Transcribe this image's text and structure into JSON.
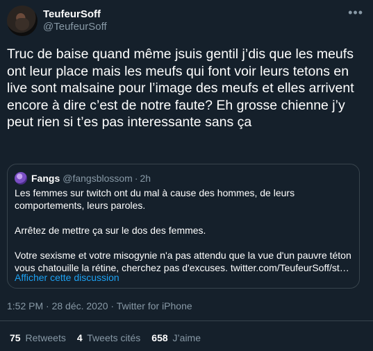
{
  "author": {
    "display_name": "TeufeurSoff",
    "handle": "@TeufeurSoff",
    "more_icon": "ellipsis-icon"
  },
  "tweet_text": "Truc de baise quand même jsuis gentil j’dis que les meufs ont leur place mais les meufs qui font voir leurs tetons en live sont malsaine pour l’image des meufs et elles arrivent encore à dire c’est de notre faute? Eh grosse chienne j’y peut rien si t’es pas interessante sans ça",
  "quoted": {
    "display_name": "Fangs",
    "handle": "@fangsblossom",
    "separator": "·",
    "time": "2h",
    "paragraphs": [
      "Les femmes sur twitch ont du mal à cause des hommes, de leurs comportements, leurs paroles.",
      "Arrêtez de mettre ça sur le dos des femmes.",
      "Votre sexisme et votre misogynie n'a pas attendu que la vue d'un pauvre téton vous chatouille la rétine, cherchez pas d'excuses. twitter.com/TeufeurSoff/st…"
    ],
    "show_thread": "Afficher cette discussion"
  },
  "meta": "1:52 PM · 28 déc. 2020 · Twitter for iPhone",
  "stats": {
    "retweets_count": "75",
    "retweets_label": "Retweets",
    "quotes_count": "4",
    "quotes_label": "Tweets cités",
    "likes_count": "658",
    "likes_label": "J’aime"
  },
  "colors": {
    "background": "#15202b",
    "secondary_text": "#8899a6",
    "link": "#1da1f2",
    "border": "#38444d"
  }
}
